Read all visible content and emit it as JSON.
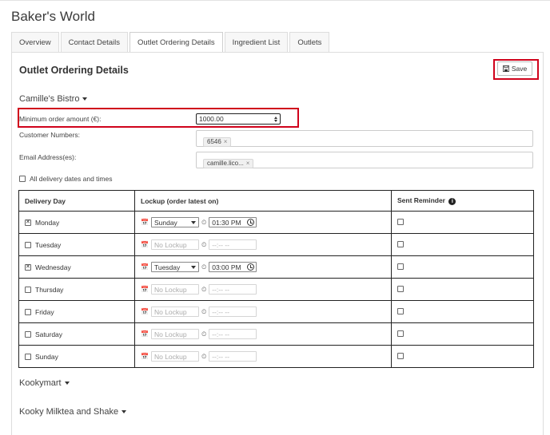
{
  "app": {
    "title": "Baker's World"
  },
  "tabs": [
    {
      "label": "Overview"
    },
    {
      "label": "Contact Details"
    },
    {
      "label": "Outlet Ordering Details"
    },
    {
      "label": "Ingredient List"
    },
    {
      "label": "Outlets"
    }
  ],
  "active_tab": "Outlet Ordering Details",
  "section": {
    "title": "Outlet Ordering Details",
    "save_label": "Save"
  },
  "outlets": {
    "expanded": {
      "name": "Camille's Bistro",
      "min_order_label": "Minimum order amount (€):",
      "min_order_value": "1000.00",
      "customer_numbers_label": "Customer Numbers:",
      "customer_numbers": [
        "6546"
      ],
      "email_label": "Email Address(es):",
      "emails": [
        "camille.lico..."
      ],
      "all_delivery_label": "All delivery dates and times",
      "table": {
        "headers": {
          "day": "Delivery Day",
          "lockup": "Lockup (order latest on)",
          "reminder": "Sent Reminder"
        },
        "rows": [
          {
            "day": "Monday",
            "checked": true,
            "lockup_day": "Sunday",
            "lockup_time": "01:30 PM",
            "enabled": true
          },
          {
            "day": "Tuesday",
            "checked": false,
            "lockup_day": "No Lockup",
            "lockup_time": "--:-- --",
            "enabled": false
          },
          {
            "day": "Wednesday",
            "checked": true,
            "lockup_day": "Tuesday",
            "lockup_time": "03:00 PM",
            "enabled": true
          },
          {
            "day": "Thursday",
            "checked": false,
            "lockup_day": "No Lockup",
            "lockup_time": "--:-- --",
            "enabled": false
          },
          {
            "day": "Friday",
            "checked": false,
            "lockup_day": "No Lockup",
            "lockup_time": "--:-- --",
            "enabled": false
          },
          {
            "day": "Saturday",
            "checked": false,
            "lockup_day": "No Lockup",
            "lockup_time": "--:-- --",
            "enabled": false
          },
          {
            "day": "Sunday",
            "checked": false,
            "lockup_day": "No Lockup",
            "lockup_time": "--:-- --",
            "enabled": false
          }
        ]
      }
    },
    "collapsed": [
      {
        "name": "Kookymart"
      },
      {
        "name": "Kooky Milktea and Shake"
      }
    ]
  },
  "colors": {
    "highlight": "#d0021b",
    "border": "#dddddd"
  },
  "icons": {
    "save": "floppy-disk-icon",
    "calendar": "calendar-icon",
    "clock": "clock-icon",
    "info": "info-icon",
    "caret": "caret-down-icon"
  }
}
